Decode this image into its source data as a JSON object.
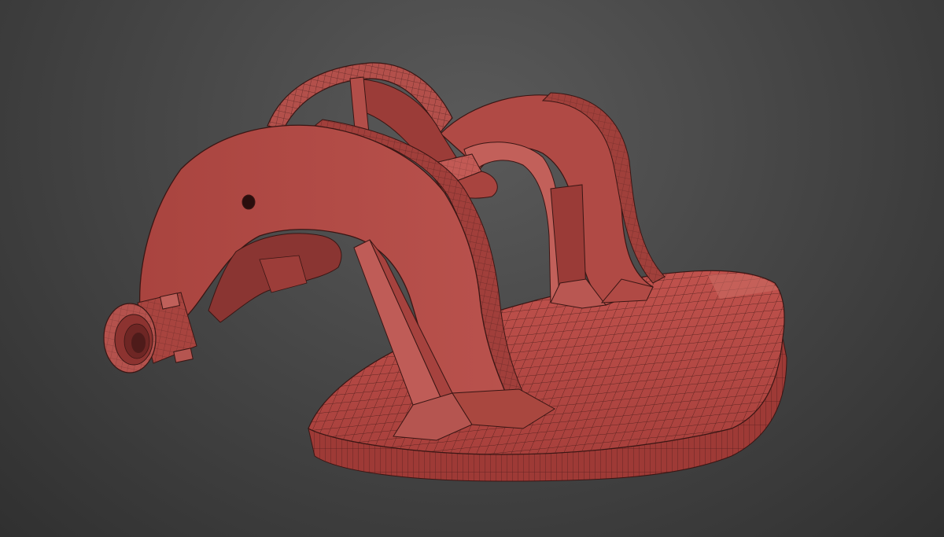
{
  "viewport": {
    "background_top": "#5a5a5a",
    "background_bottom": "#303030"
  },
  "model": {
    "surface_color": "#b8504c",
    "shade_color": "#8a3532",
    "highlight_color": "#c96a62",
    "wire_color": "#3a1614"
  }
}
